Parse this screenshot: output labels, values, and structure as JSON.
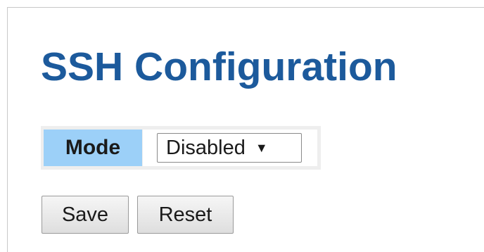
{
  "page": {
    "title": "SSH Configuration"
  },
  "config": {
    "mode_label": "Mode",
    "mode_value": "Disabled",
    "mode_dropdown_icon": "triangle-down-icon"
  },
  "actions": {
    "save_label": "Save",
    "reset_label": "Reset"
  },
  "colors": {
    "title": "#1c5a9c",
    "label_cell_bg": "#9cd0f8",
    "table_bg": "#eeeeee"
  }
}
